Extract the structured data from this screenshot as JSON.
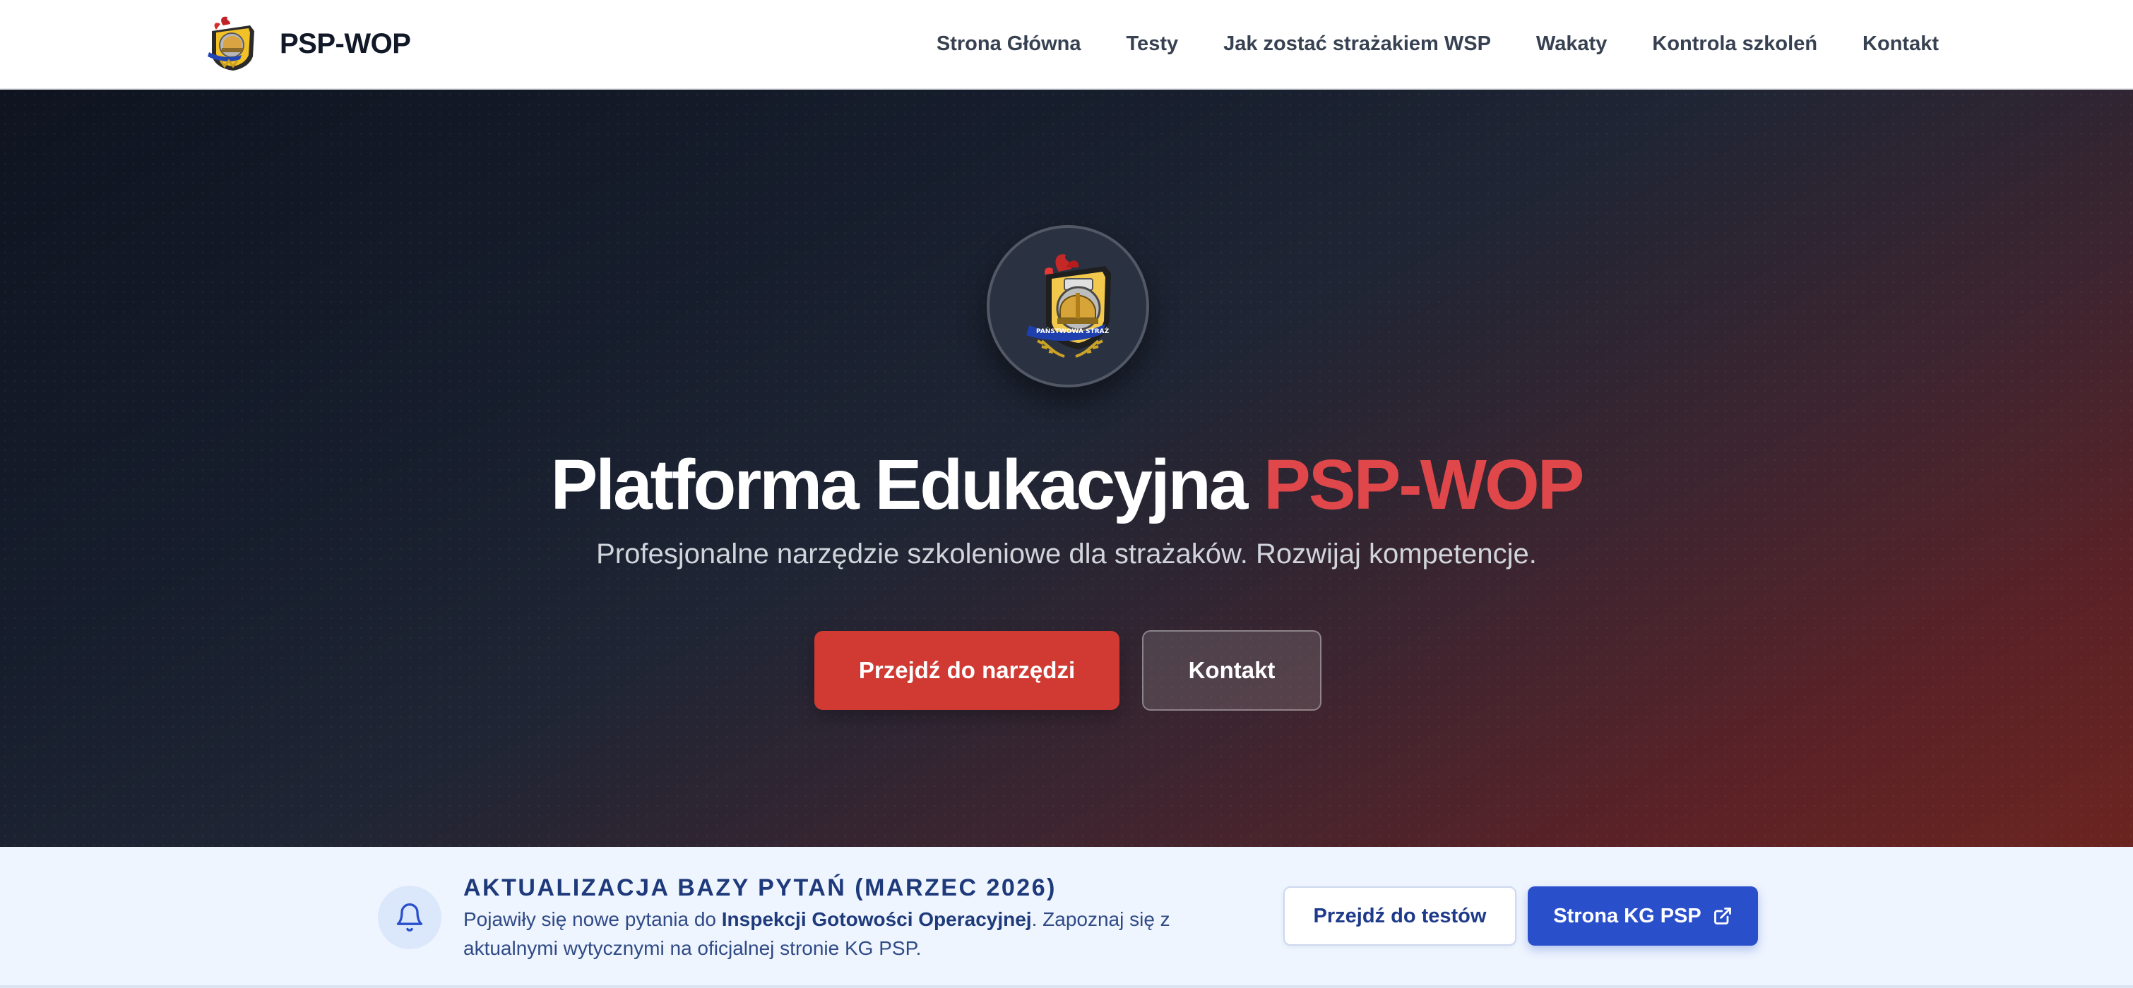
{
  "nav": {
    "brand": "PSP-WOP",
    "links": [
      "Strona Główna",
      "Testy",
      "Jak zostać strażakiem WSP",
      "Wakaty",
      "Kontrola szkoleń",
      "Kontakt"
    ]
  },
  "hero": {
    "title_main": "Platforma Edukacyjna ",
    "title_accent": "PSP-WOP",
    "subtitle": "Profesjonalne narzędzie szkoleniowe dla strażaków. Rozwijaj kompetencje.",
    "primary_button": "Przejdź do narzędzi",
    "secondary_button": "Kontakt",
    "emblem_text": "PAŃSTWOWA STRAŻ"
  },
  "announcement": {
    "title": "AKTUALIZACJA BAZY PYTAŃ (MARZEC 2026)",
    "text_before": "Pojawiły się nowe pytania do ",
    "text_bold": "Inspekcji Gotowości Operacyjnej",
    "text_after": ". Zapoznaj się z aktualnymi wytycznymi na oficjalnej stronie KG PSP.",
    "tests_button": "Przejdź do testów",
    "kgpsp_button": "Strona KG PSP"
  },
  "colors": {
    "accent_red": "#e0474a",
    "primary_button": "#d03a33",
    "announce_blue": "#2a4fcb"
  },
  "icons": {
    "announcement": "bell-icon",
    "external": "external-link-icon",
    "logo": "psp-emblem-icon"
  }
}
